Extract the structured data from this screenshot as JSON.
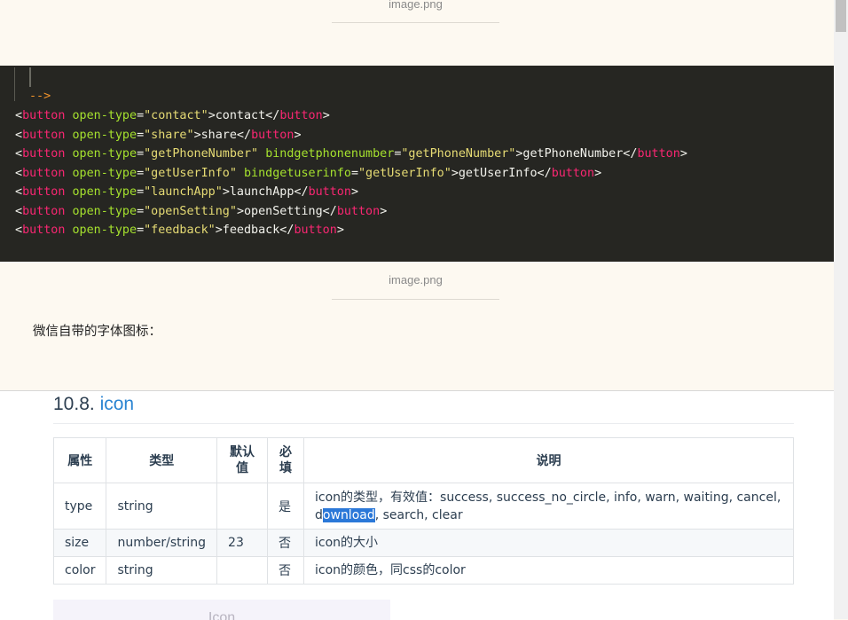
{
  "captions": {
    "top": "image.png",
    "middle": "image.png"
  },
  "code": {
    "comment_end": "-->",
    "lines": [
      {
        "open_type": "\"contact\"",
        "extra_attr": "",
        "extra_val": "",
        "text": "contact"
      },
      {
        "open_type": "\"share\"",
        "extra_attr": "",
        "extra_val": "",
        "text": "share"
      },
      {
        "open_type": "\"getPhoneNumber\"",
        "extra_attr": "bindgetphonenumber",
        "extra_val": "\"getPhoneNumber\"",
        "text": "getPhoneNumber"
      },
      {
        "open_type": "\"getUserInfo\"",
        "extra_attr": "bindgetuserinfo",
        "extra_val": "\"getUserInfo\"",
        "text": "getUserInfo"
      },
      {
        "open_type": "\"launchApp\"",
        "extra_attr": "",
        "extra_val": "",
        "text": "launchApp"
      },
      {
        "open_type": "\"openSetting\"",
        "extra_attr": "",
        "extra_val": "",
        "text": "openSetting"
      },
      {
        "open_type": "\"feedback\"",
        "extra_attr": "",
        "extra_val": "",
        "text": "feedback"
      }
    ],
    "tag_name": "button",
    "attr_name": "open-type"
  },
  "note": "微信自带的字体图标：",
  "doc": {
    "heading_number": "10.8.",
    "heading_keyword": "icon",
    "table": {
      "headers": [
        "属性",
        "类型",
        "默认值",
        "必填",
        "说明"
      ],
      "rows": [
        {
          "attr": "type",
          "type": "string",
          "default": "",
          "required": "是",
          "desc_a": "icon的类型，有效值：success, success_no_circle, info, warn, waiting, cancel, d",
          "desc_sel": "ownload",
          "desc_b": ", search, clear"
        },
        {
          "attr": "size",
          "type": "number/string",
          "default": "23",
          "required": "否",
          "desc_a": "icon的大小",
          "desc_sel": "",
          "desc_b": ""
        },
        {
          "attr": "color",
          "type": "string",
          "default": "",
          "required": "否",
          "desc_a": "icon的颜色，同css的color",
          "desc_sel": "",
          "desc_b": ""
        }
      ]
    },
    "bottom_label": "Icon"
  },
  "colors": {
    "code_bg": "#262622",
    "page_bg": "#fdf9f1",
    "tag": "#f92672",
    "attr": "#a6e22e",
    "string": "#e6db74",
    "selection": "#2b78d8"
  }
}
